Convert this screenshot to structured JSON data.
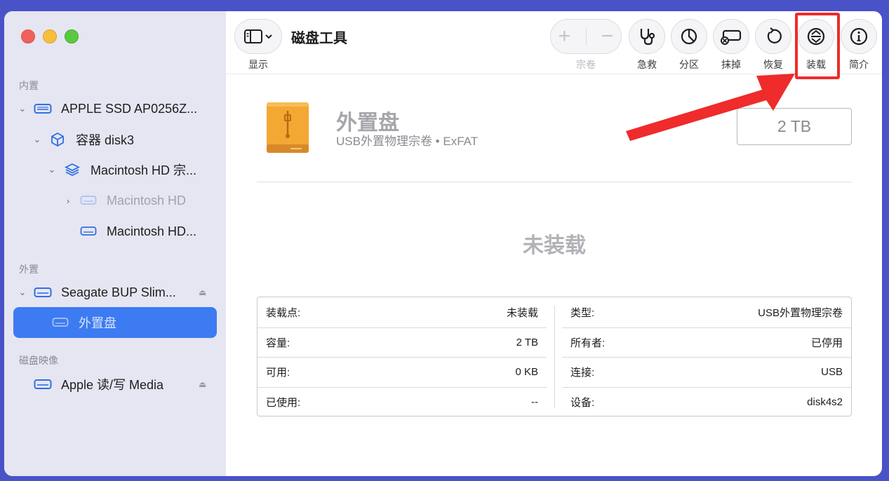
{
  "app": {
    "title": "磁盘工具"
  },
  "toolbar": {
    "view_label": "显示",
    "volume_label": "宗卷",
    "firstaid_label": "急救",
    "partition_label": "分区",
    "erase_label": "抹掉",
    "restore_label": "恢复",
    "mount_label": "装载",
    "info_label": "简介"
  },
  "sidebar": {
    "internal_header": "内置",
    "external_header": "外置",
    "images_header": "磁盘映像",
    "items": [
      {
        "label": "APPLE SSD AP0256Z..."
      },
      {
        "label": "容器 disk3"
      },
      {
        "label": "Macintosh HD  宗..."
      },
      {
        "label": "Macintosh HD"
      },
      {
        "label": "Macintosh HD..."
      },
      {
        "label": "Seagate BUP Slim..."
      },
      {
        "label": "外置盘"
      },
      {
        "label": "Apple 读/写 Media"
      }
    ],
    "eject_glyph": "⏏"
  },
  "volume": {
    "name": "外置盘",
    "subtitle": "USB外置物理宗卷 • ExFAT",
    "capacity": "2 TB",
    "status": "未装载"
  },
  "info": {
    "left": [
      {
        "key": "装载点:",
        "value": "未装载"
      },
      {
        "key": "容量:",
        "value": "2 TB"
      },
      {
        "key": "可用:",
        "value": "0 KB"
      },
      {
        "key": "已使用:",
        "value": "--"
      }
    ],
    "right": [
      {
        "key": "类型:",
        "value": "USB外置物理宗卷"
      },
      {
        "key": "所有者:",
        "value": "已停用"
      },
      {
        "key": "连接:",
        "value": "USB"
      },
      {
        "key": "设备:",
        "value": "disk4s2"
      }
    ]
  },
  "colors": {
    "accent": "#3d7bf2",
    "highlight": "#ef2b2b",
    "arrow": "#ef2b2b",
    "background": "#4a52c8"
  }
}
